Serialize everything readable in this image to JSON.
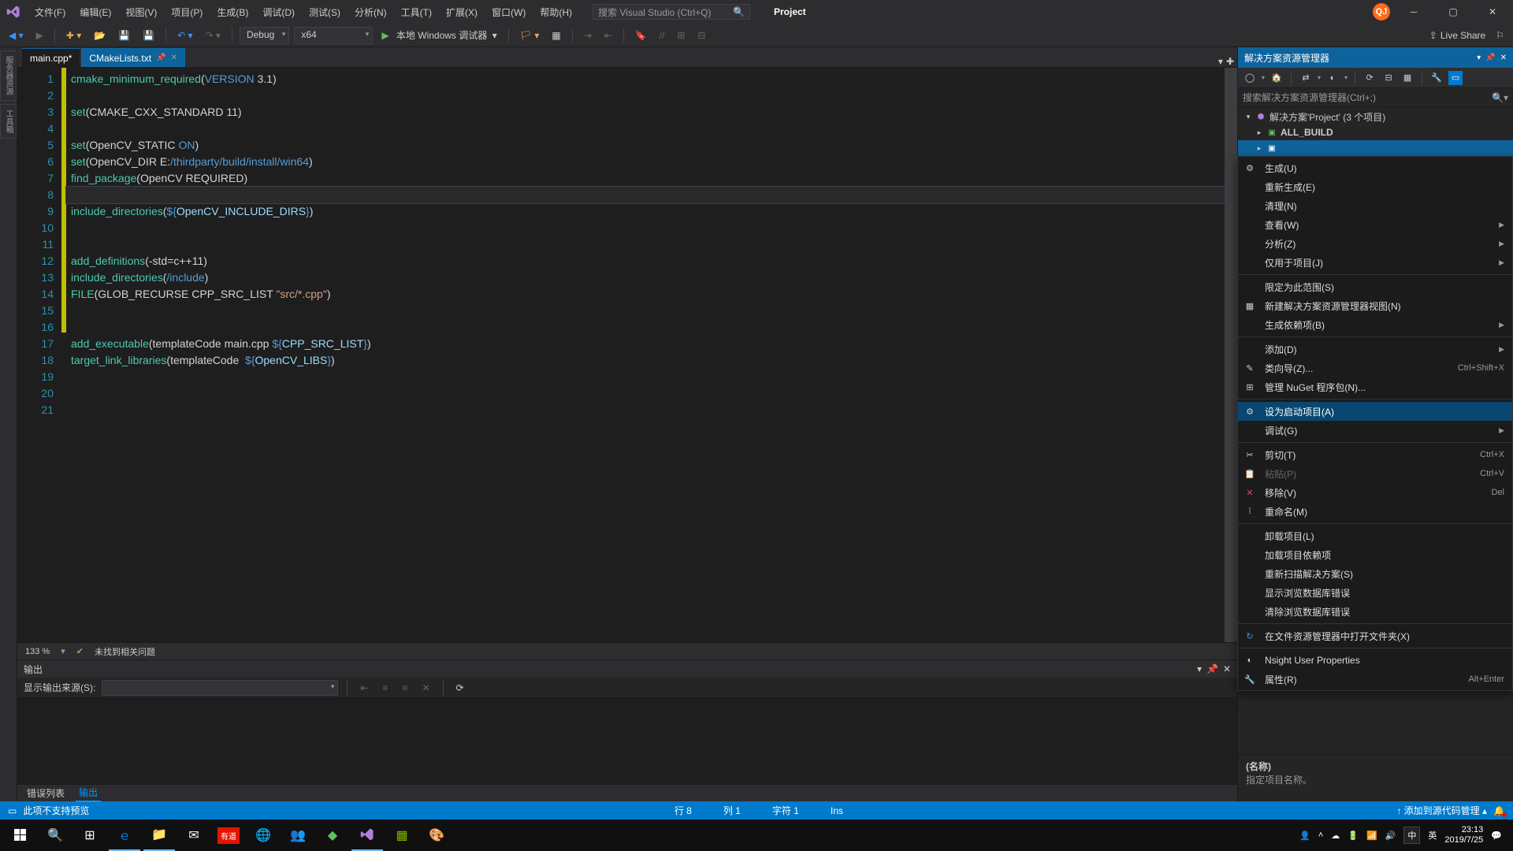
{
  "menu": [
    "文件(F)",
    "编辑(E)",
    "视图(V)",
    "项目(P)",
    "生成(B)",
    "调试(D)",
    "测试(S)",
    "分析(N)",
    "工具(T)",
    "扩展(X)",
    "窗口(W)",
    "帮助(H)"
  ],
  "search_placeholder": "搜索 Visual Studio (Ctrl+Q)",
  "project_label": "Project",
  "avatar": "QJ",
  "toolbar": {
    "config": "Debug",
    "platform": "x64",
    "debug_target": "本地 Windows 调试器",
    "live_share": "Live Share"
  },
  "tabs": [
    {
      "label": "main.cpp*",
      "active": true
    },
    {
      "label": "CMakeLists.txt",
      "selected": true
    }
  ],
  "code": {
    "lines": 21,
    "changed": [
      1,
      2,
      3,
      4,
      5,
      6,
      7,
      8,
      9,
      10,
      11,
      12,
      13,
      14,
      15,
      16
    ],
    "current_line": 8
  },
  "code_tokens": {
    "l1": [
      [
        "fn",
        "cmake_minimum_required"
      ],
      [
        "par",
        "("
      ],
      [
        "kw",
        "VERSION"
      ],
      [
        "id",
        " 3.1"
      ],
      [
        "par",
        ")"
      ]
    ],
    "l2": [],
    "l3": [
      [
        "fn",
        "set"
      ],
      [
        "par",
        "("
      ],
      [
        "id",
        "CMAKE_CXX_STANDARD 11"
      ],
      [
        "par",
        ")"
      ]
    ],
    "l4": [],
    "l5": [
      [
        "fn",
        "set"
      ],
      [
        "par",
        "("
      ],
      [
        "id",
        "OpenCV_STATIC "
      ],
      [
        "kw",
        "ON"
      ],
      [
        "par",
        ")"
      ]
    ],
    "l6": [
      [
        "fn",
        "set"
      ],
      [
        "par",
        "("
      ],
      [
        "id",
        "OpenCV_DIR E:"
      ],
      [
        "path",
        "/thirdparty/"
      ],
      [
        "kw",
        "build"
      ],
      [
        "path",
        "/"
      ],
      [
        "kw",
        "install"
      ],
      [
        "path",
        "/win64"
      ],
      [
        "par",
        ")"
      ]
    ],
    "l7": [
      [
        "fn",
        "find_package"
      ],
      [
        "par",
        "("
      ],
      [
        "id",
        "OpenCV REQUIRED"
      ],
      [
        "par",
        ")"
      ]
    ],
    "l8": [],
    "l9": [
      [
        "fn",
        "include_directories"
      ],
      [
        "par",
        "("
      ],
      [
        "kw",
        "${"
      ],
      [
        "var",
        "OpenCV_INCLUDE_DIRS"
      ],
      [
        "kw",
        "}"
      ],
      [
        "par",
        ")"
      ]
    ],
    "l10": [],
    "l11": [],
    "l12": [
      [
        "fn",
        "add_definitions"
      ],
      [
        "par",
        "("
      ],
      [
        "id",
        "-std=c++11"
      ],
      [
        "par",
        ")"
      ]
    ],
    "l13": [
      [
        "fn",
        "include_directories"
      ],
      [
        "par",
        "("
      ],
      [
        "path",
        "/include"
      ],
      [
        "par",
        ")"
      ]
    ],
    "l14": [
      [
        "fn",
        "FILE"
      ],
      [
        "par",
        "("
      ],
      [
        "id",
        "GLOB_RECURSE CPP_SRC_LIST "
      ],
      [
        "str",
        "\"src/*.cpp\""
      ],
      [
        "par",
        ")"
      ]
    ],
    "l15": [],
    "l16": [],
    "l17": [
      [
        "fn",
        "add_executable"
      ],
      [
        "par",
        "("
      ],
      [
        "id",
        "templateCode main.cpp "
      ],
      [
        "kw",
        "${"
      ],
      [
        "var",
        "CPP_SRC_LIST"
      ],
      [
        "kw",
        "}"
      ],
      [
        "par",
        ")"
      ]
    ],
    "l18": [
      [
        "fn",
        "target_link_libraries"
      ],
      [
        "par",
        "("
      ],
      [
        "id",
        "templateCode  "
      ],
      [
        "kw",
        "${"
      ],
      [
        "var",
        "OpenCV_LIBS"
      ],
      [
        "kw",
        "}"
      ],
      [
        "par",
        ")"
      ]
    ],
    "l19": [],
    "l20": [],
    "l21": []
  },
  "editor_status": {
    "zoom": "133 %",
    "issues": "未找到相关问题"
  },
  "output": {
    "title": "输出",
    "source_label": "显示输出来源(S):",
    "tabs": [
      "错误列表",
      "输出"
    ],
    "active_tab": 1
  },
  "solution": {
    "title": "解决方案资源管理器",
    "search": "搜索解决方案资源管理器(Ctrl+;)",
    "root": "解决方案'Project' (3 个项目)",
    "items": [
      "ALL_BUILD"
    ]
  },
  "context_menu": [
    {
      "icon": "⚙",
      "label": "生成(U)"
    },
    {
      "label": "重新生成(E)"
    },
    {
      "label": "清理(N)"
    },
    {
      "label": "查看(W)",
      "arrow": true
    },
    {
      "label": "分析(Z)",
      "arrow": true
    },
    {
      "label": "仅用于项目(J)",
      "arrow": true
    },
    {
      "sep": true
    },
    {
      "label": "限定为此范围(S)"
    },
    {
      "icon": "▦",
      "label": "新建解决方案资源管理器视图(N)"
    },
    {
      "label": "生成依赖项(B)",
      "arrow": true
    },
    {
      "sep": true
    },
    {
      "label": "添加(D)",
      "arrow": true
    },
    {
      "icon": "✎",
      "label": "类向导(Z)...",
      "shortcut": "Ctrl+Shift+X"
    },
    {
      "icon": "⊞",
      "label": "管理 NuGet 程序包(N)..."
    },
    {
      "sep": true
    },
    {
      "icon": "⚙",
      "label": "设为启动项目(A)",
      "hover": true
    },
    {
      "label": "调试(G)",
      "arrow": true
    },
    {
      "sep": true
    },
    {
      "icon": "✂",
      "label": "剪切(T)",
      "shortcut": "Ctrl+X"
    },
    {
      "icon": "📋",
      "label": "粘贴(P)",
      "shortcut": "Ctrl+V",
      "disabled": true
    },
    {
      "icon": "✕",
      "label": "移除(V)",
      "shortcut": "Del",
      "iconcolor": "#e74856"
    },
    {
      "icon": "⁞",
      "label": "重命名(M)"
    },
    {
      "sep": true
    },
    {
      "label": "卸载项目(L)"
    },
    {
      "label": "加载项目依赖项"
    },
    {
      "label": "重新扫描解决方案(S)"
    },
    {
      "label": "显示浏览数据库错误"
    },
    {
      "label": "清除浏览数据库错误"
    },
    {
      "sep": true
    },
    {
      "icon": "↻",
      "label": "在文件资源管理器中打开文件夹(X)",
      "iconcolor": "#3794ff"
    },
    {
      "sep": true
    },
    {
      "icon": "◐",
      "label": "Nsight User Properties"
    },
    {
      "icon": "🔧",
      "label": "属性(R)",
      "shortcut": "Alt+Enter"
    }
  ],
  "properties": {
    "name": "(名称)",
    "desc": "指定项目名称。"
  },
  "statusbar": {
    "preview": "此项不支持预览",
    "row": "行 8",
    "col": "列 1",
    "char": "字符 1",
    "ins": "Ins",
    "source_ctrl": "添加到源代码管理"
  },
  "taskbar": {
    "ime1": "中",
    "ime2": "英",
    "time": "23:13",
    "date": "2019/7/25"
  }
}
